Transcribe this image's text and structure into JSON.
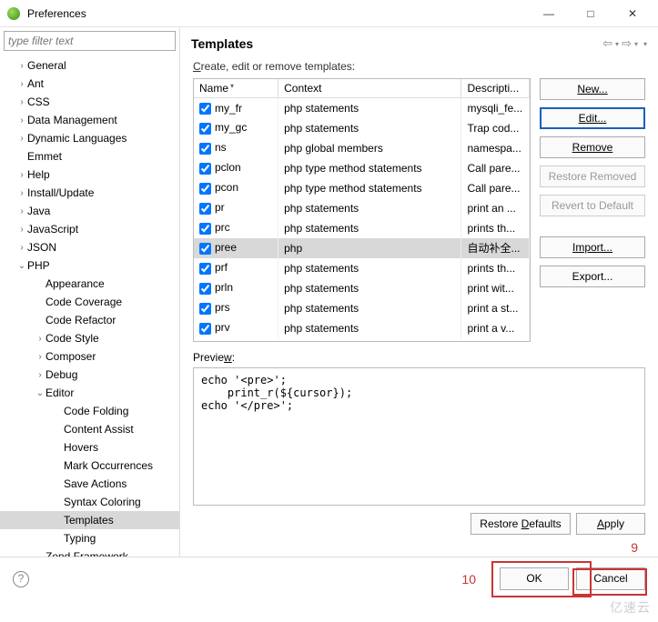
{
  "window": {
    "title": "Preferences"
  },
  "sidebar": {
    "filter_placeholder": "type filter text",
    "items": [
      {
        "label": "General",
        "depth": 1,
        "tw": "›"
      },
      {
        "label": "Ant",
        "depth": 1,
        "tw": "›"
      },
      {
        "label": "CSS",
        "depth": 1,
        "tw": "›"
      },
      {
        "label": "Data Management",
        "depth": 1,
        "tw": "›"
      },
      {
        "label": "Dynamic Languages",
        "depth": 1,
        "tw": "›"
      },
      {
        "label": "Emmet",
        "depth": 1,
        "tw": ""
      },
      {
        "label": "Help",
        "depth": 1,
        "tw": "›"
      },
      {
        "label": "Install/Update",
        "depth": 1,
        "tw": "›"
      },
      {
        "label": "Java",
        "depth": 1,
        "tw": "›"
      },
      {
        "label": "JavaScript",
        "depth": 1,
        "tw": "›"
      },
      {
        "label": "JSON",
        "depth": 1,
        "tw": "›"
      },
      {
        "label": "PHP",
        "depth": 1,
        "tw": "⌄"
      },
      {
        "label": "Appearance",
        "depth": 2,
        "tw": ""
      },
      {
        "label": "Code Coverage",
        "depth": 2,
        "tw": ""
      },
      {
        "label": "Code Refactor",
        "depth": 2,
        "tw": ""
      },
      {
        "label": "Code Style",
        "depth": 2,
        "tw": "›"
      },
      {
        "label": "Composer",
        "depth": 2,
        "tw": "›"
      },
      {
        "label": "Debug",
        "depth": 2,
        "tw": "›"
      },
      {
        "label": "Editor",
        "depth": 2,
        "tw": "⌄"
      },
      {
        "label": "Code Folding",
        "depth": 3,
        "tw": ""
      },
      {
        "label": "Content Assist",
        "depth": 3,
        "tw": ""
      },
      {
        "label": "Hovers",
        "depth": 3,
        "tw": ""
      },
      {
        "label": "Mark Occurrences",
        "depth": 3,
        "tw": ""
      },
      {
        "label": "Save Actions",
        "depth": 3,
        "tw": ""
      },
      {
        "label": "Syntax Coloring",
        "depth": 3,
        "tw": ""
      },
      {
        "label": "Templates",
        "depth": 3,
        "tw": "",
        "selected": true
      },
      {
        "label": "Typing",
        "depth": 3,
        "tw": ""
      },
      {
        "label": "Zend Framework",
        "depth": 2,
        "tw": ""
      }
    ]
  },
  "content": {
    "heading": "Templates",
    "subheading_pre": "C",
    "subheading_rest": "reate, edit or remove templates:",
    "columns": {
      "name": "Name",
      "context": "Context",
      "desc": "Descripti..."
    },
    "rows": [
      {
        "name": "my_fr",
        "ctx": "php statements",
        "desc": "mysqli_fe..."
      },
      {
        "name": "my_gc",
        "ctx": "php statements",
        "desc": "Trap cod..."
      },
      {
        "name": "ns",
        "ctx": "php global members",
        "desc": "namespa..."
      },
      {
        "name": "pclon",
        "ctx": "php type method statements",
        "desc": "Call pare..."
      },
      {
        "name": "pcon",
        "ctx": "php type method statements",
        "desc": "Call pare..."
      },
      {
        "name": "pr",
        "ctx": "php statements",
        "desc": "print an ..."
      },
      {
        "name": "prc",
        "ctx": "php statements",
        "desc": "prints th..."
      },
      {
        "name": "pree",
        "ctx": "php",
        "desc": "自动补全...",
        "selected": true
      },
      {
        "name": "prf",
        "ctx": "php statements",
        "desc": "prints th..."
      },
      {
        "name": "prln",
        "ctx": "php statements",
        "desc": "print wit..."
      },
      {
        "name": "prs",
        "ctx": "php statements",
        "desc": "print a st..."
      },
      {
        "name": "prv",
        "ctx": "php statements",
        "desc": "print a v..."
      }
    ],
    "buttons": {
      "new": "New...",
      "edit": "Edit...",
      "remove": "Remove",
      "restore_removed": "Restore Removed",
      "revert": "Revert to Default",
      "import": "Import...",
      "export": "Export..."
    },
    "preview_label_pre": "Previe",
    "preview_label_u": "w",
    "preview_label_post": ":",
    "preview_text": "echo '<pre>';\n    print_r(${cursor});\necho '</pre>';",
    "restore_defaults_pre": "Restore ",
    "restore_defaults_u": "D",
    "restore_defaults_post": "efaults",
    "apply_u": "A",
    "apply_post": "pply"
  },
  "bottom": {
    "ok": "OK",
    "cancel": "Cancel"
  },
  "annotations": {
    "n9": "9",
    "n10": "10"
  },
  "watermark": "亿速云"
}
